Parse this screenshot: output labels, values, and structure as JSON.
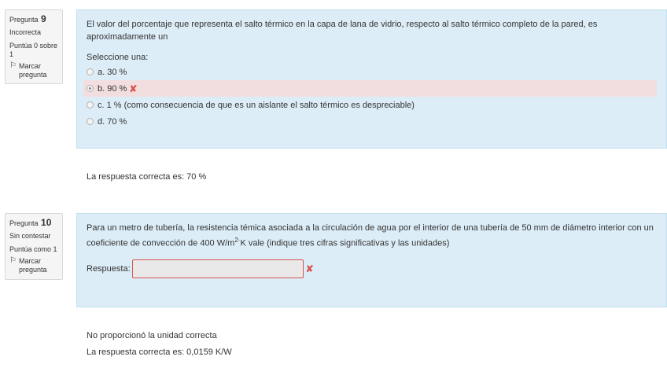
{
  "q9": {
    "label": "Pregunta",
    "number": "9",
    "state": "Incorrecta",
    "grade": "Puntúa 0 sobre 1",
    "flag_label": "Marcar pregunta",
    "text": "El valor del porcentaje que representa el salto térmico en la capa de lana de vidrio, respecto al salto térmico completo de la pared, es aproximadamente un",
    "prompt": "Seleccione una:",
    "options": [
      {
        "label": "a. 30 %"
      },
      {
        "label": "b. 90 %"
      },
      {
        "label": "c. 1 % (como consecuencia de que es un aislante el salto térmico es despreciable)"
      },
      {
        "label": "d. 70 %"
      }
    ],
    "right_answer": "La respuesta correcta es: 70 %"
  },
  "q10": {
    "label": "Pregunta",
    "number": "10",
    "state": "Sin contestar",
    "grade": "Puntúa como 1",
    "flag_label": "Marcar pregunta",
    "text_part1": "Para un metro de tubería, la resistencia témica asociada a la circulación de agua por el interior de una tubería de 50 mm de diámetro interior con un coeficiente de convección de 400 W/m",
    "text_sup": "2",
    "text_dot": "·",
    "text_part2": "K vale (indique tres cifras significativas y las unidades)",
    "answer_label": "Respuesta:",
    "answer_value": "",
    "feedback": "No proporcionó la unidad correcta",
    "right_answer": "La respuesta correcta es: 0,0159 K/W"
  },
  "colors": {
    "content_bg": "#dcedf7",
    "wrong_bg": "#f2dede",
    "error_red": "#d9534f"
  },
  "icons": {
    "flag": "flag-icon",
    "incorrect": "cross-icon"
  }
}
